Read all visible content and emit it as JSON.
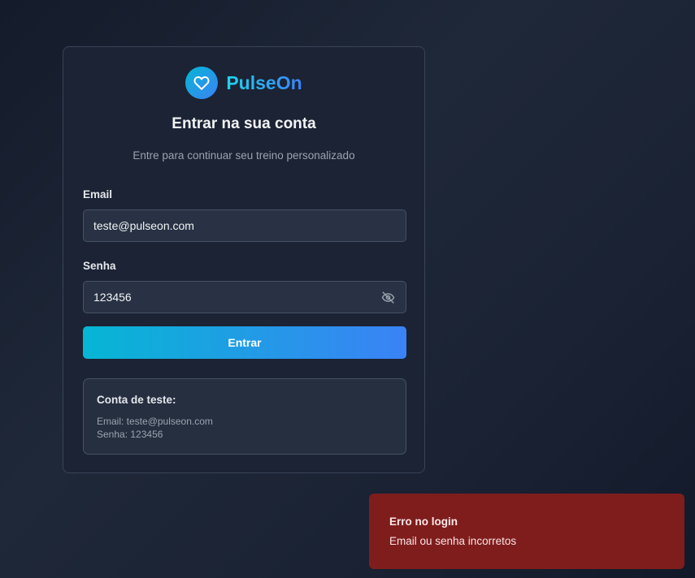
{
  "brand": {
    "name": "PulseOn",
    "logo_icon": "heart-icon"
  },
  "login": {
    "title": "Entrar na sua conta",
    "subtitle": "Entre para continuar seu treino personalizado",
    "email_label": "Email",
    "email_value": "teste@pulseon.com",
    "password_label": "Senha",
    "password_value": "123456",
    "password_toggle_icon": "eye-off-icon",
    "submit_label": "Entrar"
  },
  "test_account": {
    "title": "Conta de teste:",
    "email_line": "Email: teste@pulseon.com",
    "password_line": "Senha: 123456"
  },
  "toast": {
    "title": "Erro no login",
    "message": "Email ou senha incorretos"
  },
  "colors": {
    "accent_start": "#06b6d4",
    "accent_end": "#3b82f6",
    "error_bg": "#7f1d1d",
    "card_bg": "#1b2334"
  }
}
